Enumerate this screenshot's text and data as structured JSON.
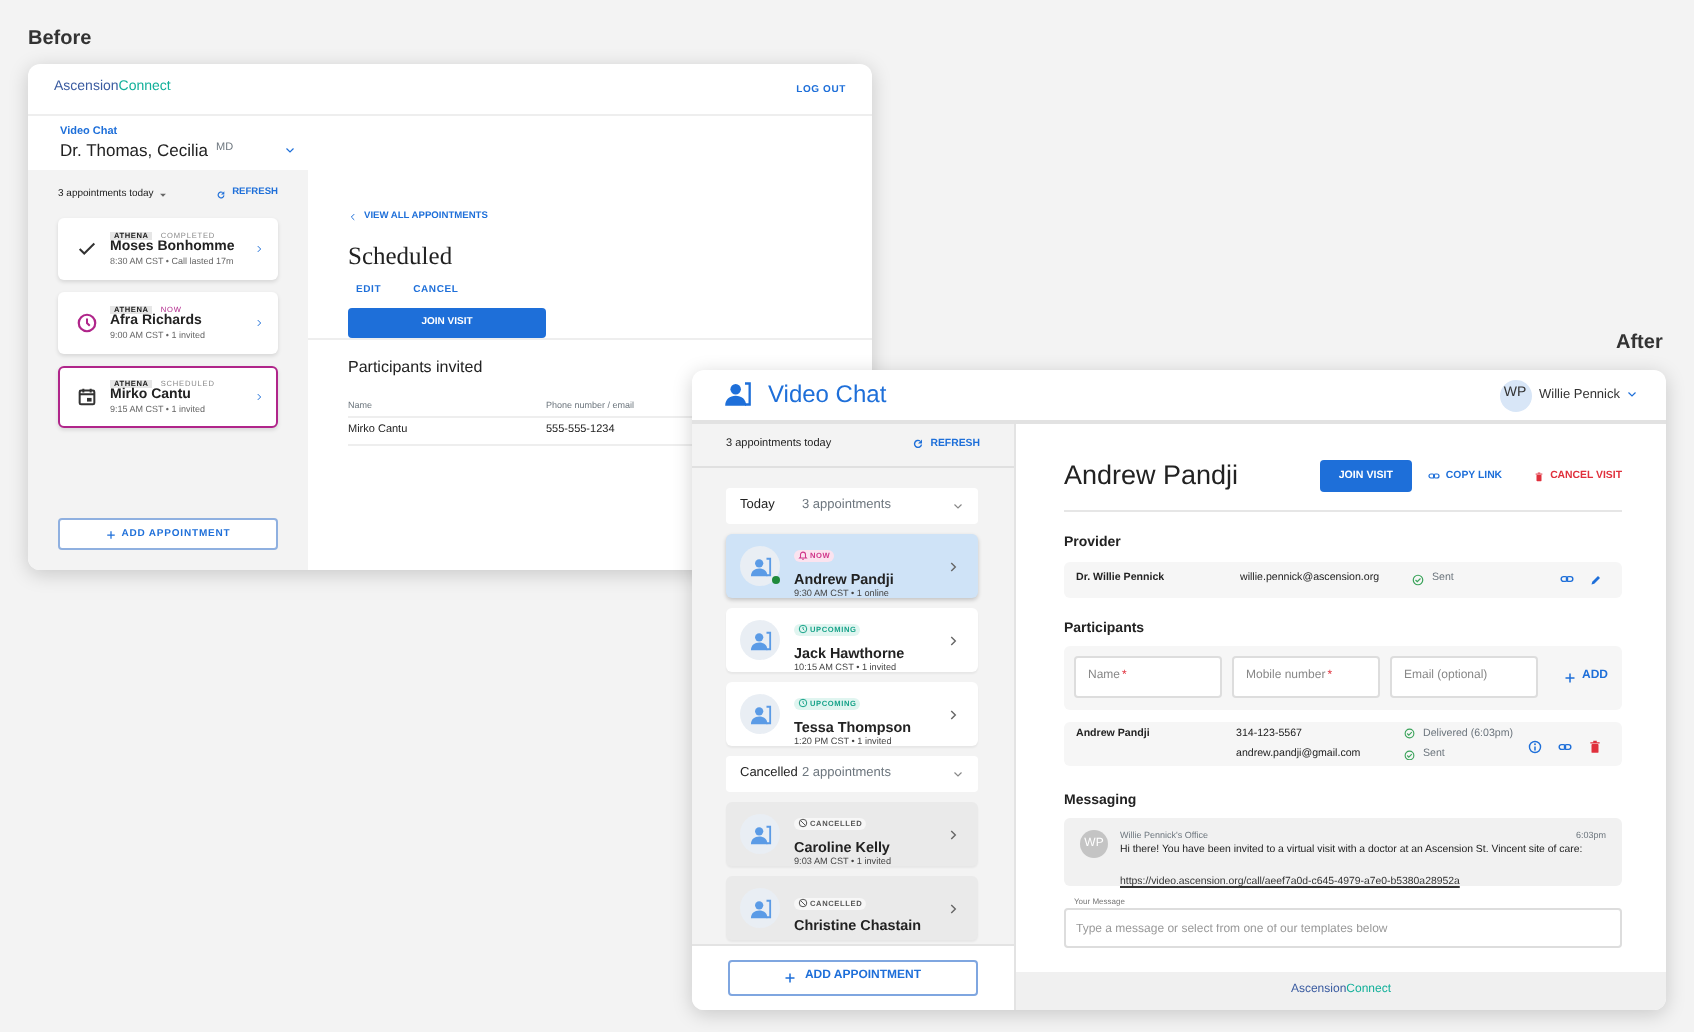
{
  "labels": {
    "before": "Before",
    "after": "After"
  },
  "before": {
    "logo": {
      "first": "Ascension",
      "second": "Connect"
    },
    "logout": "LOG OUT",
    "app_label": "Video Chat",
    "doctor": "Dr. Thomas, Cecilia",
    "doctor_suffix": "MD",
    "appointments_summary": "3 appointments today",
    "refresh": "REFRESH",
    "appointments": [
      {
        "source": "ATHENA",
        "status": "COMPLETED",
        "kind": "completed",
        "name": "Moses Bonhomme",
        "meta": "8:30 AM CST • Call lasted 17m",
        "selected": false
      },
      {
        "source": "ATHENA",
        "status": "NOW",
        "kind": "now",
        "name": "Afra Richards",
        "meta": "9:00 AM CST • 1 invited",
        "selected": false
      },
      {
        "source": "ATHENA",
        "status": "SCHEDULED",
        "kind": "scheduled",
        "name": "Mirko Cantu",
        "meta": "9:15 AM CST • 1 invited",
        "selected": true
      }
    ],
    "add_button": "ADD APPOINTMENT",
    "back_link": "VIEW ALL APPOINTMENTS",
    "title": "Scheduled",
    "actions": [
      "EDIT",
      "CANCEL"
    ],
    "join_button": "JOIN VISIT",
    "participants_title": "Participants invited",
    "columns": [
      "Name",
      "Phone number / email"
    ],
    "rows": [
      [
        "Mirko Cantu",
        "555-555-1234"
      ]
    ]
  },
  "after": {
    "title": "Video Chat",
    "user": {
      "initials": "WP",
      "name": "Willie Pennick"
    },
    "appointments_summary": "3 appointments today",
    "refresh": "REFRESH",
    "groups": [
      {
        "label": "Today",
        "count": "3 appointments",
        "expanded": true,
        "items": [
          {
            "status": "NOW",
            "kind": "now",
            "name": "Andrew Pandji",
            "meta": "9:30 AM CST • 1 online",
            "online": true,
            "selected": true
          },
          {
            "status": "UPCOMING",
            "kind": "upcoming",
            "name": "Jack Hawthorne",
            "meta": "10:15 AM CST • 1 invited",
            "online": false,
            "selected": false
          },
          {
            "status": "UPCOMING",
            "kind": "upcoming",
            "name": "Tessa Thompson",
            "meta": "1:20 PM CST • 1 invited",
            "online": false,
            "selected": false
          }
        ]
      },
      {
        "label": "Cancelled",
        "count": "2 appointments",
        "expanded": true,
        "items": [
          {
            "status": "CANCELLED",
            "kind": "cancelled",
            "name": "Caroline Kelly",
            "meta": "9:03 AM CST • 1 invited",
            "online": false,
            "selected": false
          },
          {
            "status": "CANCELLED",
            "kind": "cancelled",
            "name": "Christine Chastain",
            "online": false,
            "selected": false
          }
        ]
      }
    ],
    "add_button": "ADD APPOINTMENT",
    "patient": "Andrew Pandji",
    "join_button": "JOIN VISIT",
    "copy_link": "COPY LINK",
    "cancel_visit": "CANCEL VISIT",
    "provider_title": "Provider",
    "provider": {
      "name": "Dr. Willie Pennick",
      "email": "willie.pennick@ascension.org",
      "status": "Sent"
    },
    "participants_title": "Participants",
    "fields": [
      {
        "placeholder": "Name",
        "required_mark": "*"
      },
      {
        "placeholder": "Mobile number",
        "required_mark": "*"
      },
      {
        "placeholder": "Email (optional)"
      }
    ],
    "add_participant": "ADD",
    "participants": [
      {
        "name": "Andrew Pandji",
        "phone": "314-123-5567",
        "email": "andrew.pandji@gmail.com",
        "statuses": [
          "Delivered (6:03pm)",
          "Sent"
        ]
      }
    ],
    "messaging_title": "Messaging",
    "messages": [
      {
        "initials": "WP",
        "sender": "Willie Pennick's Office",
        "time": "6:03pm",
        "text": "Hi there! You have been invited to a virtual visit with a doctor at an Ascension St. Vincent site of care:",
        "link": "https://video.ascension.org/call/aeef7a0d-c645-4979-a7e0-b5380a28952a"
      }
    ],
    "message_box": {
      "label": "Your Message",
      "placeholder": "Type a message or select from one of our templates below"
    },
    "footer_logo": {
      "first": "Ascension",
      "second": "Connect"
    }
  }
}
